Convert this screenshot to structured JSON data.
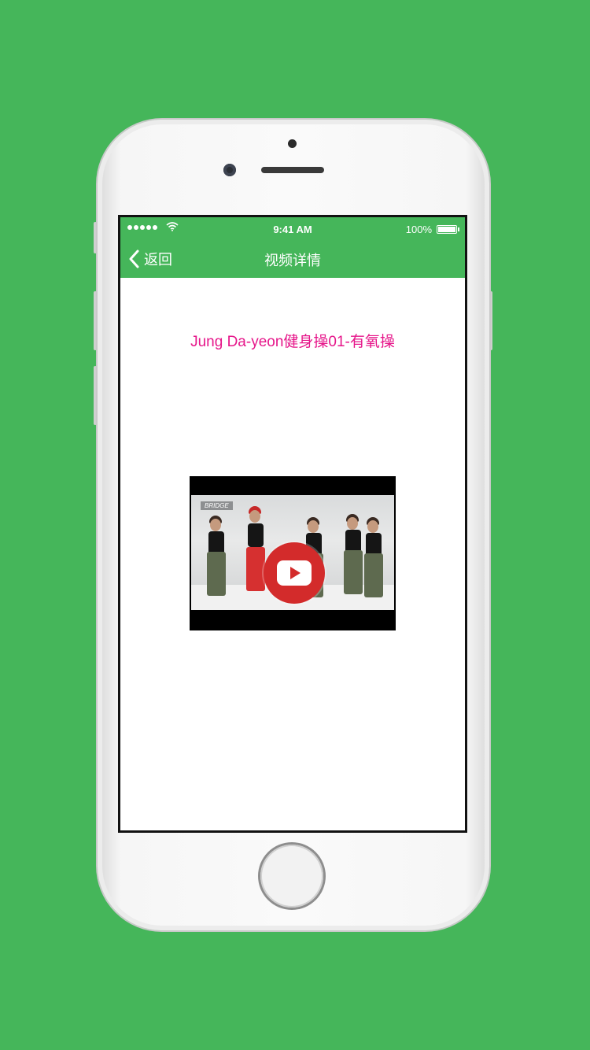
{
  "status_bar": {
    "time": "9:41 AM",
    "battery_percent": "100%",
    "signal_bars": 5,
    "wifi_icon": "wifi-icon",
    "battery_icon": "battery-icon"
  },
  "nav": {
    "back_label": "返回",
    "title": "视频详情",
    "back_icon": "chevron-left-icon"
  },
  "video": {
    "title": "Jung Da-yeon健身操01-有氧操",
    "frame_tag": "BRIDGE",
    "play_icon": "play-icon"
  },
  "colors": {
    "background": "#45b65a",
    "nav_bar": "#45b65a",
    "title_text": "#e6168a",
    "play_button": "#d32b2b"
  }
}
